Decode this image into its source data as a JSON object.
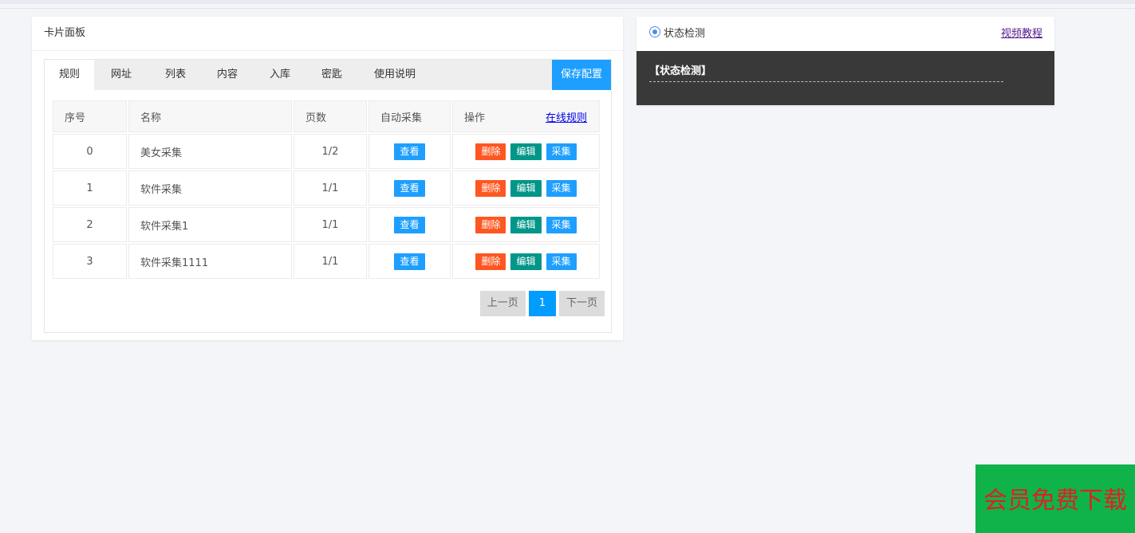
{
  "left_card": {
    "title": "卡片面板",
    "tabs": [
      "规则",
      "网址",
      "列表",
      "内容",
      "入库",
      "密匙",
      "使用说明"
    ],
    "save_button": "保存配置",
    "table": {
      "headers": [
        "序号",
        "名称",
        "页数",
        "自动采集",
        "操作"
      ],
      "online_rules_link": "在线规则",
      "rows": [
        {
          "index": "0",
          "name": "美女采集",
          "pages": "1/2",
          "view": "查看",
          "delete": "删除",
          "edit": "编辑",
          "collect": "采集"
        },
        {
          "index": "1",
          "name": "软件采集",
          "pages": "1/1",
          "view": "查看",
          "delete": "删除",
          "edit": "编辑",
          "collect": "采集"
        },
        {
          "index": "2",
          "name": "软件采集1",
          "pages": "1/1",
          "view": "查看",
          "delete": "删除",
          "edit": "编辑",
          "collect": "采集"
        },
        {
          "index": "3",
          "name": "软件采集1111",
          "pages": "1/1",
          "view": "查看",
          "delete": "删除",
          "edit": "编辑",
          "collect": "采集"
        }
      ]
    },
    "pager": {
      "prev": "上一页",
      "current": "1",
      "next": "下一页"
    }
  },
  "right_card": {
    "title": "状态检测",
    "icon": "target-icon",
    "video_link": "视频教程",
    "console_text": "【状态检测】"
  },
  "promo": {
    "text": "会员免费下载"
  },
  "colors": {
    "primary": "#1e9fff",
    "danger": "#ff5722",
    "success": "#009688",
    "console_bg": "#393939",
    "promo_bg": "#0fb34a",
    "promo_text": "#e02020"
  }
}
